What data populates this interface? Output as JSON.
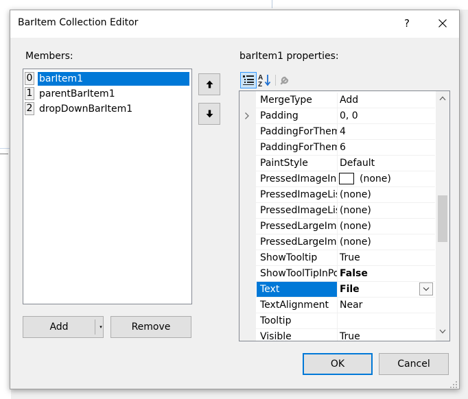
{
  "dialog": {
    "title": "BarItem Collection Editor",
    "help_label": "?",
    "members_label": "Members:",
    "properties_label": "barItem1 properties:"
  },
  "members": [
    {
      "index": "0",
      "name": "barItem1",
      "selected": true
    },
    {
      "index": "1",
      "name": "parentBarItem1",
      "selected": false
    },
    {
      "index": "2",
      "name": "dropDownBarItem1",
      "selected": false
    }
  ],
  "buttons": {
    "add": "Add",
    "add_dropdown_glyph": "▾",
    "remove": "Remove",
    "ok": "OK",
    "cancel": "Cancel"
  },
  "property_grid": {
    "rows": [
      {
        "name": "MergeType",
        "value": "Add"
      },
      {
        "name": "Padding",
        "value": "0, 0",
        "expandable": true
      },
      {
        "name": "PaddingForTheme",
        "value": "4"
      },
      {
        "name": "PaddingForTheme",
        "value": "6"
      },
      {
        "name": "PaintStyle",
        "value": "Default"
      },
      {
        "name": "PressedImageIndex",
        "value": "(none)",
        "swatch": true
      },
      {
        "name": "PressedImageList",
        "value": "(none)"
      },
      {
        "name": "PressedImageList",
        "value": "(none)"
      },
      {
        "name": "PressedLargeImage",
        "value": "(none)"
      },
      {
        "name": "PressedLargeImage",
        "value": "(none)"
      },
      {
        "name": "ShowTooltip",
        "value": "True"
      },
      {
        "name": "ShowToolTipInPopup",
        "value": "False",
        "bold": true
      },
      {
        "name": "Text",
        "value": "File",
        "bold": true,
        "selected": true,
        "dropdown": true
      },
      {
        "name": "TextAlignment",
        "value": "Near"
      },
      {
        "name": "Tooltip",
        "value": ""
      },
      {
        "name": "Visible",
        "value": "True"
      }
    ]
  },
  "colors": {
    "selection": "#0078d7",
    "dialog_bg": "#f0f0f0",
    "button_bg": "#e1e1e1"
  },
  "icons": {
    "categorized": "categorized-icon",
    "alphabetical": "alphabetical-sort-icon",
    "property_pages": "wrench-icon",
    "move_up": "arrow-up-icon",
    "move_down": "arrow-down-icon",
    "close": "close-icon"
  }
}
